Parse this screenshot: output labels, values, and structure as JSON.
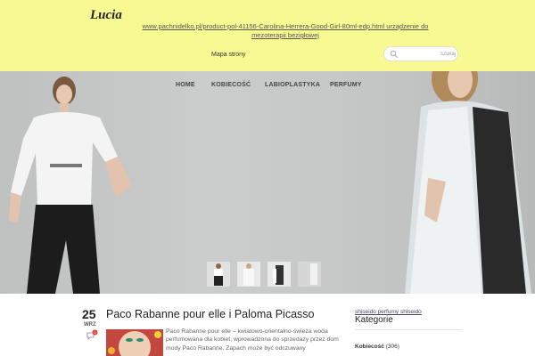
{
  "header": {
    "brand": "Lucia",
    "top_link": "www.pachnidelko.pl/product-pol-41156-Carolina-Herrera-Good-Girl-80ml-edp.html urządzenie do mezoterapii bezigłowej",
    "sitemap_label": "Mapa strony",
    "search": {
      "placeholder": "szukaj"
    }
  },
  "nav": {
    "items": [
      {
        "label": "HOME"
      },
      {
        "label": "KOBIECOŚĆ"
      },
      {
        "label": "LABIOPLASTYKA"
      },
      {
        "label": "PERFUMY"
      }
    ]
  },
  "slider": {
    "slide_count": 4,
    "active_index": 0
  },
  "post": {
    "day": "25",
    "month": "WRZ",
    "comment_count": "0",
    "title": "Paco Rabanne pour elle i Paloma Picasso",
    "excerpt": "Paco Rabanne pour elle – kwiatowo-orientalno-świeża woda perfumowana dla kobiet, wprowadzona do sprzedaży przez dom mody Paco Rabanne. Zapach może być odczuwany"
  },
  "sidebar": {
    "top_link": "shiseido perfumy shiseido",
    "heading": "Kategorie",
    "categories": [
      {
        "name": "Kobiecość",
        "count": "(306)"
      }
    ]
  },
  "colors": {
    "header_bg": "#f8f993",
    "badge_red": "#e23b3b"
  }
}
